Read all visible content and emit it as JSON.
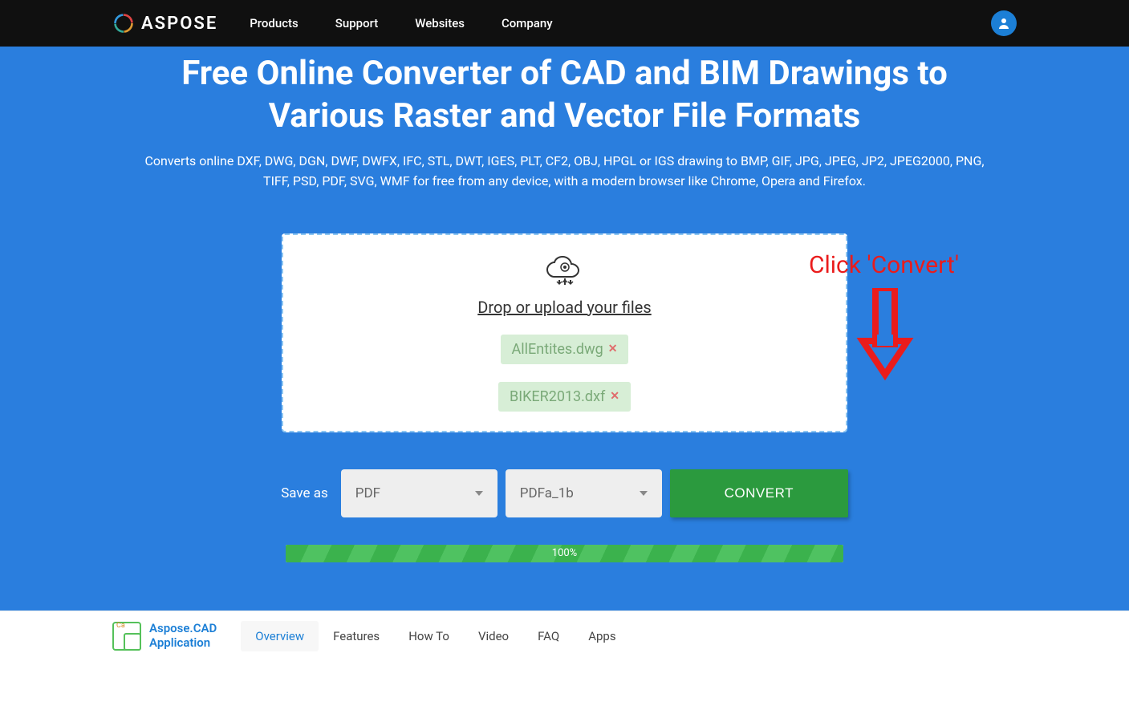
{
  "brand": "ASPOSE",
  "nav": [
    "Products",
    "Support",
    "Websites",
    "Company"
  ],
  "hero": {
    "title": "Free Online Converter of CAD and BIM Drawings to Various Raster and Vector File Formats",
    "subtitle": "Converts online DXF, DWG, DGN, DWF, DWFX, IFC, STL, DWT, IGES, PLT, CF2, OBJ, HPGL or IGS drawing to BMP, GIF, JPG, JPEG, JP2, JPEG2000, PNG, TIFF, PSD, PDF, SVG, WMF for free from any device, with a modern browser like Chrome, Opera and Firefox."
  },
  "drop": {
    "label": "Drop or upload your files",
    "files": [
      "AllEntites.dwg",
      "BIKER2013.dxf"
    ]
  },
  "saveas": {
    "label": "Save as",
    "format": "PDF",
    "subformat": "PDFa_1b"
  },
  "convert": "CONVERT",
  "progress": "100%",
  "annotation": "Click 'Convert'",
  "app": {
    "line1": "Aspose.CAD",
    "line2": "Application"
  },
  "tabs": [
    "Overview",
    "Features",
    "How To",
    "Video",
    "FAQ",
    "Apps"
  ]
}
